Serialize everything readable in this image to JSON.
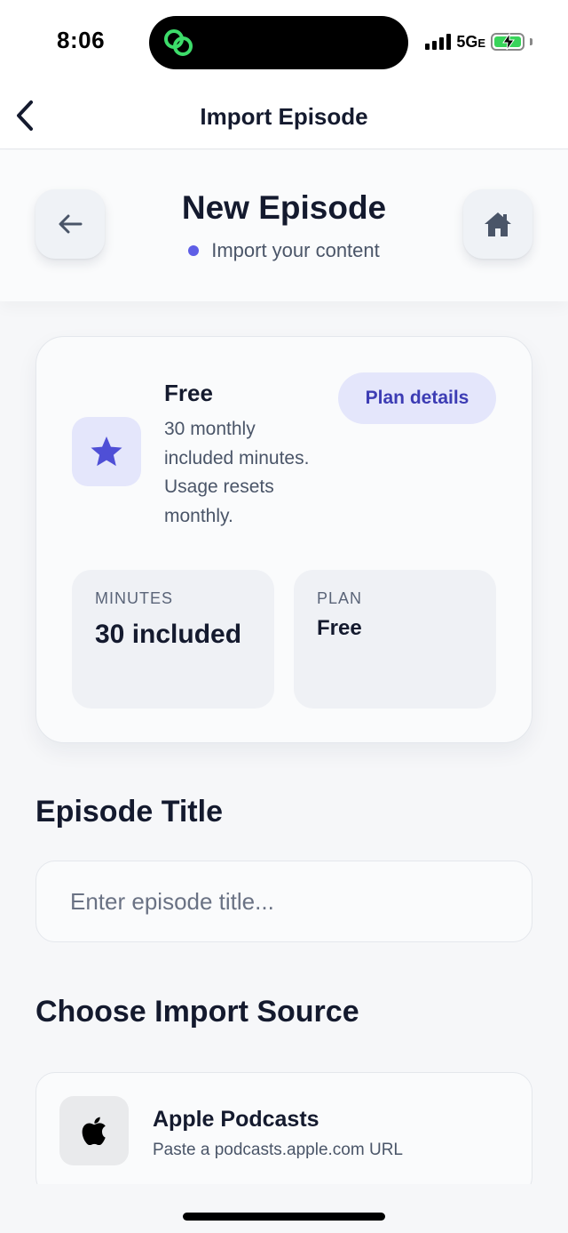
{
  "status_bar": {
    "time": "8:06",
    "network": "5G",
    "network_suffix": "E",
    "island_icon": "link-rings-icon",
    "battery_state": "charging"
  },
  "nav": {
    "title": "Import Episode",
    "back_icon": "chevron-left-icon"
  },
  "header": {
    "title": "New Episode",
    "subtitle": "Import your content",
    "accent_color": "#5e5ee6",
    "left_icon": "arrow-left-icon",
    "right_icon": "home-icon"
  },
  "plan_card": {
    "name": "Free",
    "description": "30 monthly included minutes. Usage resets monthly.",
    "details_button": "Plan details",
    "icon": "star-icon",
    "stats": {
      "minutes_label": "MINUTES",
      "minutes_value": "30 included",
      "plan_label": "PLAN",
      "plan_value": "Free"
    }
  },
  "episode_title": {
    "heading": "Episode Title",
    "placeholder": "Enter episode title...",
    "value": ""
  },
  "import_source": {
    "heading": "Choose Import Source",
    "sources": [
      {
        "name": "Apple Podcasts",
        "description": "Paste a podcasts.apple.com URL",
        "icon": "apple-icon"
      }
    ]
  }
}
